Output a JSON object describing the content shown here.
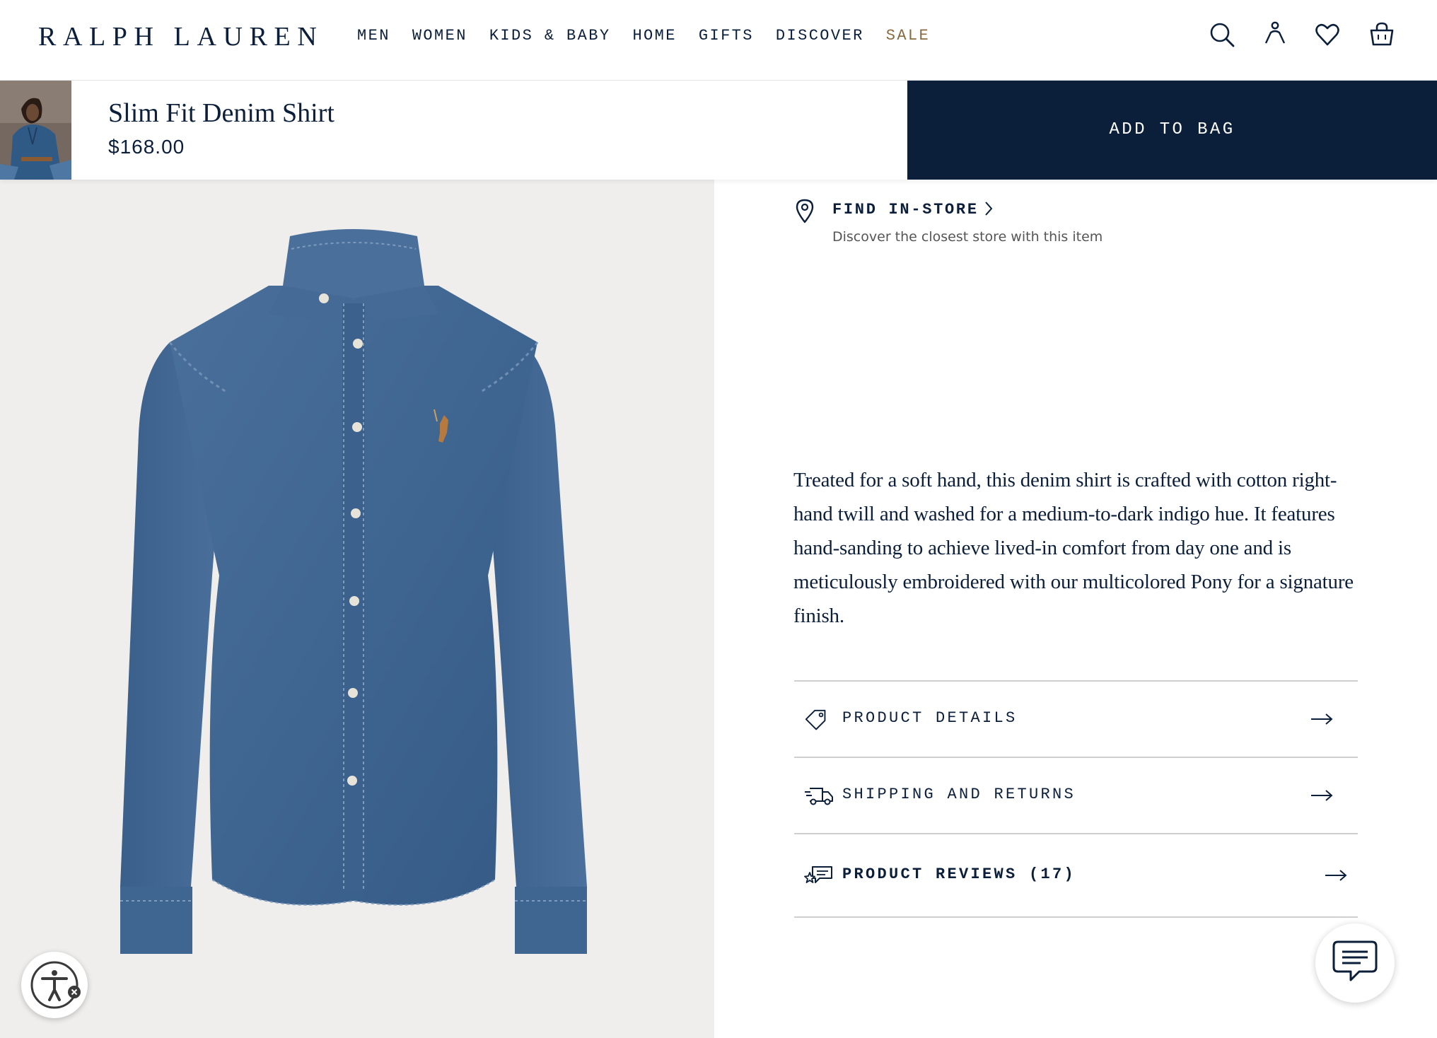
{
  "brand": {
    "logo_text": "RALPH LAUREN"
  },
  "nav": {
    "items": [
      {
        "label": "MEN"
      },
      {
        "label": "WOMEN"
      },
      {
        "label": "KIDS & BABY"
      },
      {
        "label": "HOME"
      },
      {
        "label": "GIFTS"
      },
      {
        "label": "DISCOVER"
      },
      {
        "label": "SALE",
        "color": "#8a6a3f"
      }
    ]
  },
  "header_icons": [
    "search-icon",
    "account-icon",
    "wishlist-heart-icon",
    "shopping-bag-icon"
  ],
  "sticky_bar": {
    "product_name": "Slim Fit Denim Shirt",
    "price": "$168.00",
    "add_to_bag_label": "ADD TO BAG",
    "button_color": "#0c1f3a"
  },
  "find_store": {
    "title": "FIND IN-STORE",
    "subtitle": "Discover the closest store with this item"
  },
  "description": "Treated for a soft hand, this denim shirt is crafted with cotton right-hand twill and washed for a medium-to-dark indigo hue. It features hand-sanding to achieve lived-in comfort from day one and is meticulously embroidered with our multicolored Pony for a signature finish.",
  "accordion": [
    {
      "label": "PRODUCT DETAILS",
      "icon": "tag-icon"
    },
    {
      "label": "SHIPPING AND RETURNS",
      "icon": "delivery-truck-icon"
    },
    {
      "label": "PRODUCT REVIEWS (17)",
      "icon": "reviews-icon"
    }
  ],
  "floating": {
    "accessibility_icon": "accessibility-icon",
    "chat_icon": "chat-icon"
  }
}
